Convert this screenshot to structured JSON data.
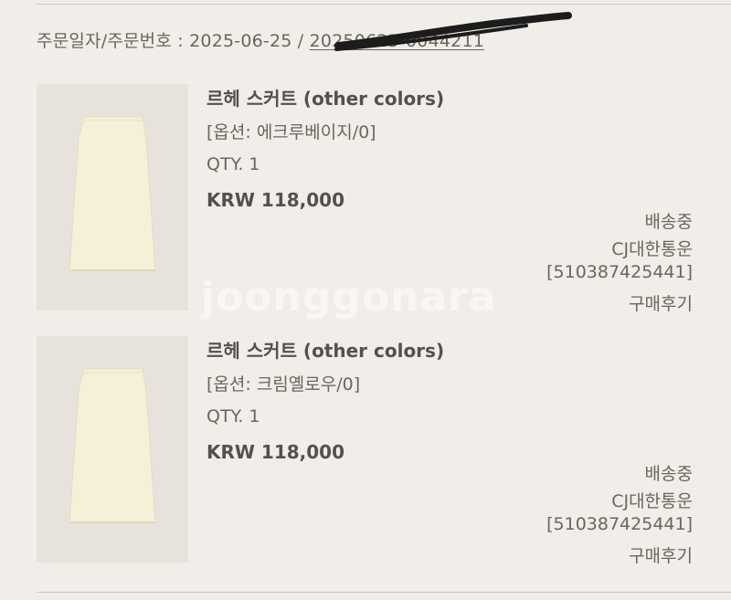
{
  "order": {
    "label": "주문일자/주문번호 : ",
    "date": "2025-06-25",
    "separator": " / ",
    "number": "20250625-0044211"
  },
  "items": [
    {
      "name": "르헤 스커트 (other colors)",
      "option": "[옵션: 에크루베이지/0]",
      "qty": "QTY. 1",
      "price": "KRW 118,000",
      "status": "배송중",
      "carrier": "CJ대한통운",
      "tracking": "[510387425441]",
      "review": "구매후기"
    },
    {
      "name": "르헤 스커트 (other colors)",
      "option": "[옵션: 크림옐로우/0]",
      "qty": "QTY. 1",
      "price": "KRW 118,000",
      "status": "배송중",
      "carrier": "CJ대한통운",
      "tracking": "[510387425441]",
      "review": "구매후기"
    }
  ],
  "watermark": "joonggonara",
  "colors": {
    "background": "#f1ede8",
    "thumb_bg": "#e7e3dc",
    "skirt": "#f5f0d8",
    "text": "#6b655f",
    "bold_text": "#55504b",
    "redaction": "#1c1c1c"
  }
}
